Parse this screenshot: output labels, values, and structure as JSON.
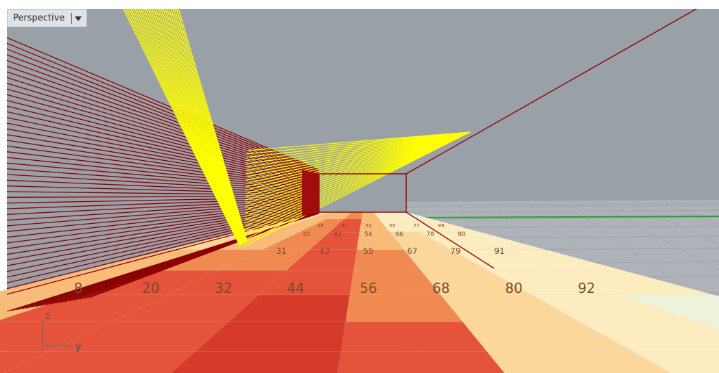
{
  "viewport": {
    "title": "Perspective",
    "menu_icon": "triangle-down-icon"
  },
  "axes": {
    "z_label": "z",
    "y_label": "y"
  },
  "grid_labels": {
    "front": [
      "8",
      "20",
      "32",
      "44",
      "56",
      "68",
      "80",
      "92"
    ],
    "second": [
      "31",
      "43",
      "55",
      "67",
      "79",
      "91"
    ],
    "third": [
      "30",
      "42",
      "54",
      "66",
      "78",
      "90"
    ],
    "fourth": [
      "29",
      "41",
      "53",
      "65",
      "77",
      "89"
    ]
  },
  "colors": {
    "background": "#9aa0a7",
    "floor_plane": "#aeb3b9",
    "ruled_lines": "#8b0000",
    "rays": "#ffff00",
    "green_axis": "#2ca02c",
    "heat_dark": "#d63a2a",
    "heat_red": "#e4533a",
    "heat_orange": "#f08a50",
    "heat_light_orange": "#f9bb78",
    "heat_peach": "#fcd79c",
    "heat_pale": "#fdecc0",
    "heat_cream": "#eef3dc"
  }
}
